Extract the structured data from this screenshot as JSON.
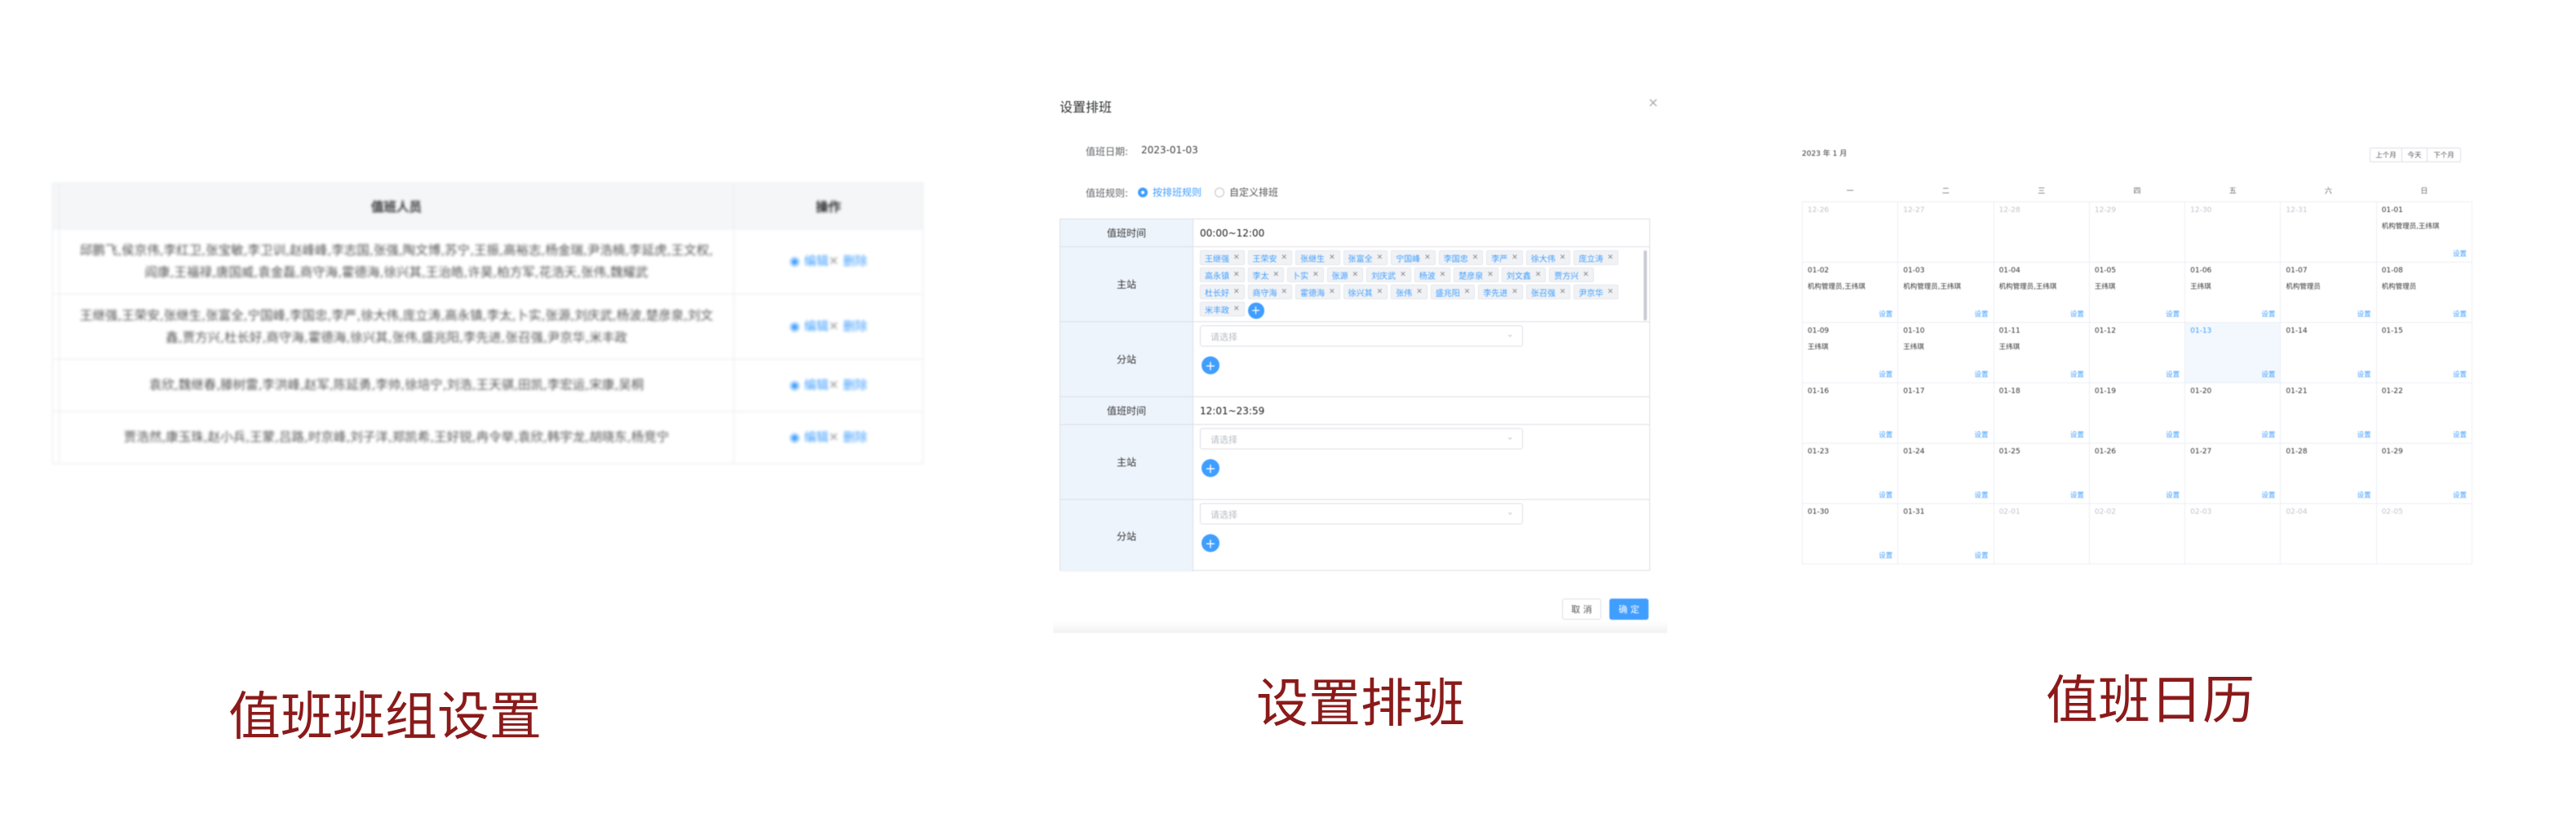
{
  "panel1": {
    "caption": "值班班组设置",
    "headers": [
      "值班人员",
      "操作"
    ],
    "rows": [
      "邱鹏飞,侯京伟,李红卫,张宝敏,李卫训,赵峰峰,李志国,张强,陶文博,苏宁,王振,高裕志,杨金瑞,尹浩楠,李延虎,王文权,阎康,王福禄,唐国威,袁金磊,商守海,霍德海,徐兴其,王治皓,许昊,柏方军,花浩天,张伟,魏耀武",
      "王继强,王荣安,张继生,张富全,宁国峰,李国忠,李严,徐大伟,庞立涛,高永镇,李太,卜实,张源,刘庆武,杨波,楚彦泉,刘文鑫,贾方兴,杜长好,商守海,霍德海,徐兴其,张伟,盛兆阳,李先进,张召强,尹京华,米丰政",
      "袁欣,魏继春,滕树雷,李洪峰,赵军,陈延勇,李帅,徐培宁,刘浩,王天骐,田凯,李宏运,宋康,吴桐",
      "贾浩然,康玉珠,赵小兵,王蒙,吕路,时京峰,刘子洋,郑凯希,王好锐,冉令举,袁欣,韩宇龙,胡晓东,杨竞宁"
    ],
    "edit_label": "编辑",
    "delete_label": "删除",
    "edit_icon": "eye-icon",
    "delete_icon": "close-icon"
  },
  "panel2": {
    "caption": "设置排班",
    "dialog_title": "设置排班",
    "date_label": "值班日期:",
    "date_value": "2023-01-03",
    "rule_label": "值班规则:",
    "rule_options": [
      "按排班规则",
      "自定义排班"
    ],
    "shifts": [
      {
        "time_label": "值班时间",
        "time_value": "00:00~12:00",
        "main_label": "主站",
        "main_tags": [
          "王继强",
          "王荣安",
          "张继生",
          "张富全",
          "宁国峰",
          "李国忠",
          "李严",
          "徐大伟",
          "庞立涛",
          "高永镇",
          "李太",
          "卜实",
          "张源",
          "刘庆武",
          "杨波",
          "楚彦泉",
          "刘文鑫",
          "贾方兴",
          "杜长好",
          "商守海",
          "霍德海",
          "徐兴其",
          "张伟",
          "盛兆阳",
          "李先进",
          "张召强",
          "尹京华",
          "米丰政"
        ],
        "sub_label": "分站",
        "sub_placeholder": "请选择"
      },
      {
        "time_label": "值班时间",
        "time_value": "12:01~23:59",
        "main_label": "主站",
        "main_placeholder": "请选择",
        "sub_label": "分站",
        "sub_placeholder": "请选择"
      }
    ],
    "cancel_label": "取 消",
    "confirm_label": "确 定",
    "accent": "#409eff"
  },
  "panel3": {
    "caption": "值班日历",
    "month_title": "2023 年 1 月",
    "nav": [
      "上个月",
      "今天",
      "下个月"
    ],
    "weekdays": [
      "一",
      "二",
      "三",
      "四",
      "五",
      "六",
      "日"
    ],
    "set_label": "设置",
    "weeks": [
      [
        {
          "d": "12-26",
          "g": true
        },
        {
          "d": "12-27",
          "g": true
        },
        {
          "d": "12-28",
          "g": true
        },
        {
          "d": "12-29",
          "g": true
        },
        {
          "d": "12-30",
          "g": true
        },
        {
          "d": "12-31",
          "g": true
        },
        {
          "d": "01-01",
          "s": "机构管理员,王纬琪"
        }
      ],
      [
        {
          "d": "01-02",
          "s": "机构管理员,王纬琪"
        },
        {
          "d": "01-03",
          "s": "机构管理员,王纬琪"
        },
        {
          "d": "01-04",
          "s": "机构管理员,王纬琪"
        },
        {
          "d": "01-05",
          "s": "王纬琪"
        },
        {
          "d": "01-06",
          "s": "王纬琪"
        },
        {
          "d": "01-07",
          "s": "机构管理员"
        },
        {
          "d": "01-08",
          "s": "机构管理员"
        }
      ],
      [
        {
          "d": "01-09",
          "s": "王纬琪"
        },
        {
          "d": "01-10",
          "s": "王纬琪"
        },
        {
          "d": "01-11",
          "s": "王纬琪"
        },
        {
          "d": "01-12"
        },
        {
          "d": "01-13",
          "t": true
        },
        {
          "d": "01-14"
        },
        {
          "d": "01-15"
        }
      ],
      [
        {
          "d": "01-16"
        },
        {
          "d": "01-17"
        },
        {
          "d": "01-18"
        },
        {
          "d": "01-19"
        },
        {
          "d": "01-20"
        },
        {
          "d": "01-21"
        },
        {
          "d": "01-22"
        }
      ],
      [
        {
          "d": "01-23"
        },
        {
          "d": "01-24"
        },
        {
          "d": "01-25"
        },
        {
          "d": "01-26"
        },
        {
          "d": "01-27"
        },
        {
          "d": "01-28"
        },
        {
          "d": "01-29"
        }
      ],
      [
        {
          "d": "01-30"
        },
        {
          "d": "01-31"
        },
        {
          "d": "02-01",
          "g": true,
          "n": true
        },
        {
          "d": "02-02",
          "g": true,
          "n": true
        },
        {
          "d": "02-03",
          "g": true,
          "n": true
        },
        {
          "d": "02-04",
          "g": true,
          "n": true
        },
        {
          "d": "02-05",
          "g": true,
          "n": true
        }
      ]
    ]
  }
}
